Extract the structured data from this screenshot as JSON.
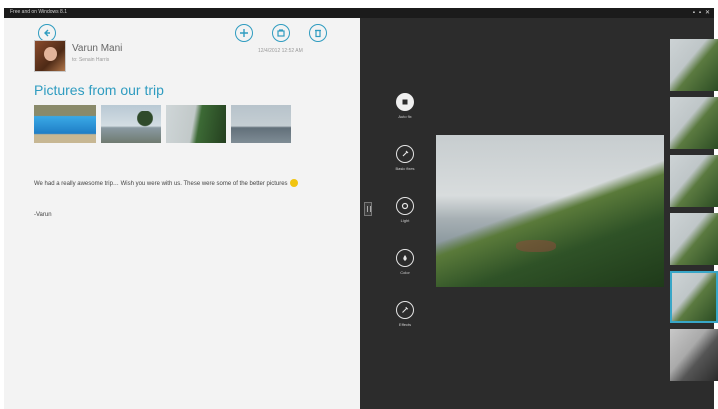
{
  "window": {
    "title": "Free and on Windows 8.1",
    "controls": [
      "▪",
      "▪",
      "✕"
    ]
  },
  "mail": {
    "sender": "Varun Mani",
    "to": "to: Senain Harris",
    "date": "12/4/2012  12:52 AM",
    "subject": "Pictures from our trip",
    "body": "We had a really awesome trip… Wish you were with us. These were some of the better pictures",
    "signature": "-Varun"
  },
  "photo_tools": [
    {
      "label": "Auto fix",
      "icon": "auto-fix-icon"
    },
    {
      "label": "Basic fixes",
      "icon": "basic-fix-icon"
    },
    {
      "label": "Light",
      "icon": "light-icon"
    },
    {
      "label": "Color",
      "icon": "color-icon"
    },
    {
      "label": "Effects",
      "icon": "effects-icon"
    }
  ],
  "colors": {
    "accent": "#2f9cc0",
    "dark_pane": "#2c2c2c",
    "light_pane": "#f3f3f3"
  }
}
